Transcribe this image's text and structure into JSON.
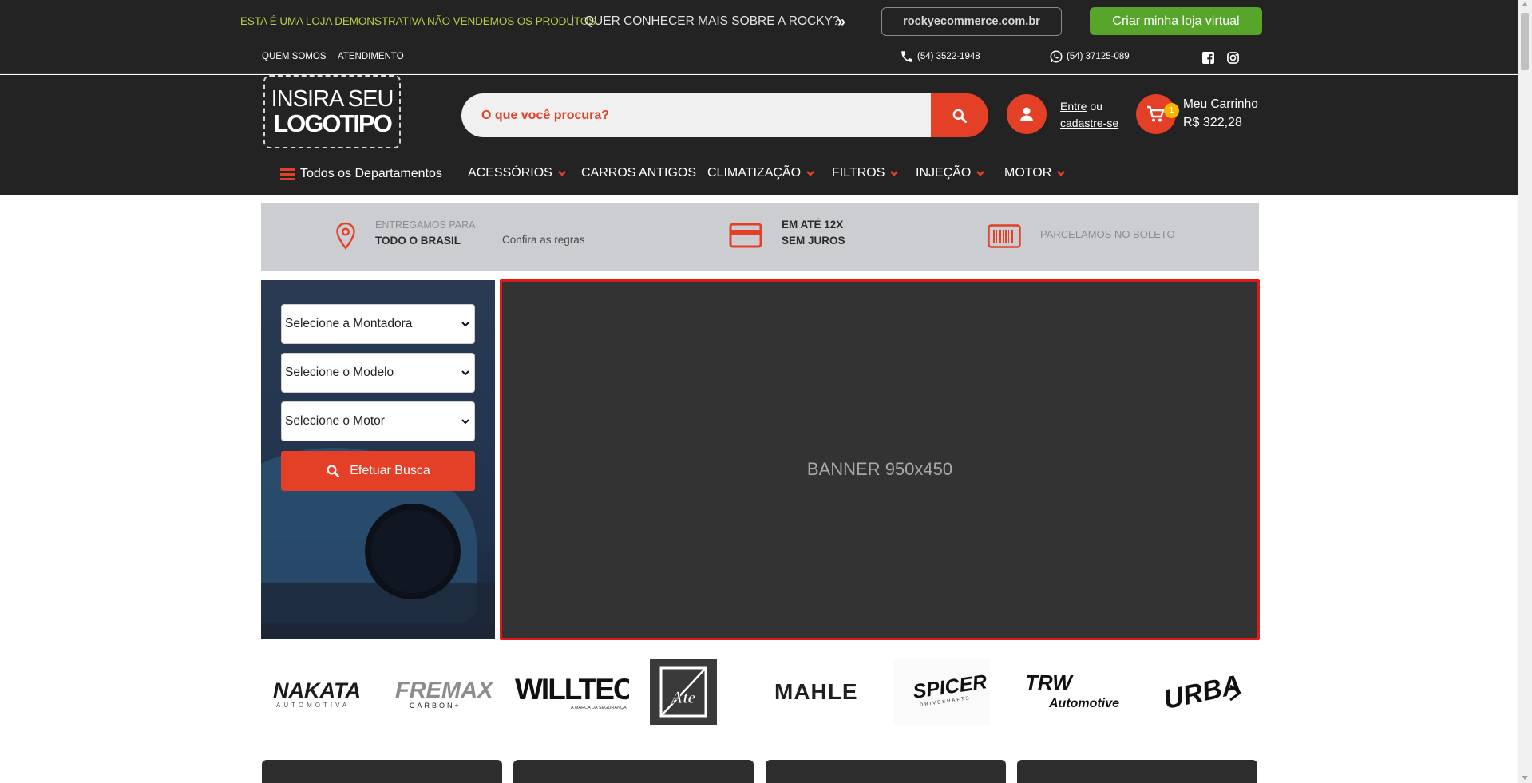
{
  "promo": {
    "demo_notice": "ESTA É UMA LOJA DEMONSTRATIVA NÃO VENDEMOS OS PRODUTOS",
    "separator": "|",
    "know_more": "QUER CONHECER MAIS SOBRE A ROCKY?",
    "arrows": "»",
    "domain": "rockyecommerce.com.br",
    "cta": "Criar minha loja virtual",
    "demo_color": "#b9cf45",
    "cta_color": "#58a52c"
  },
  "toplinks": {
    "about": "QUEM SOMOS",
    "support": "ATENDIMENTO",
    "phone": "(54) 3522-1948",
    "whatsapp": "(54) 37125-089",
    "icons": [
      "phone-icon",
      "whatsapp-icon",
      "facebook-icon",
      "instagram-icon"
    ]
  },
  "header": {
    "logo_line1": "INSIRA SEU",
    "logo_line2": "LOGOTIPO",
    "search_placeholder": "O que você procura?",
    "login_prefix": "Entre",
    "login_or": " ou",
    "register": "cadastre-se",
    "cart_title": "Meu Carrinho",
    "cart_total": "R$ 322,28",
    "cart_count": "1",
    "accent": "#e43f27",
    "badge_color": "#f7b500"
  },
  "nav": {
    "all_departments": "Todos os Departamentos",
    "items": [
      {
        "label": "ACESSÓRIOS",
        "dropdown": true
      },
      {
        "label": "CARROS ANTIGOS",
        "dropdown": false
      },
      {
        "label": "CLIMATIZAÇÃO",
        "dropdown": true
      },
      {
        "label": "FILTROS",
        "dropdown": true
      },
      {
        "label": "INJEÇÃO",
        "dropdown": true
      },
      {
        "label": "MOTOR",
        "dropdown": true
      }
    ]
  },
  "benefits": {
    "delivery_small": "ENTREGAMOS PARA",
    "delivery_bold": "TODO O BRASIL",
    "rules_link": "Confira as regras",
    "installments_line1": "EM ATÉ 12X",
    "installments_line2": "SEM JUROS",
    "boleto": "PARCELAMOS NO BOLETO"
  },
  "vehicle_search": {
    "brand_select": "Selecione a Montadora",
    "model_select": "Selecione o Modelo",
    "engine_select": "Selecione o Motor",
    "button": "Efetuar Busca"
  },
  "banner": {
    "label": "BANNER 950x450",
    "border_color": "#e01a1a"
  },
  "brands": [
    {
      "name": "NAKATA",
      "sub": "AUTOMOTIVA"
    },
    {
      "name": "FREMAX",
      "sub": "CARBON+"
    },
    {
      "name": "WILLTEC",
      "sub": "A MARCA DA SEGURANÇA"
    },
    {
      "name": "Ate",
      "sub": ""
    },
    {
      "name": "MAHLE",
      "sub": ""
    },
    {
      "name": "SPICER",
      "sub": "DRIVESHAFTS"
    },
    {
      "name": "TRW",
      "sub": "Automotive"
    },
    {
      "name": "URBA",
      "sub": ""
    }
  ]
}
